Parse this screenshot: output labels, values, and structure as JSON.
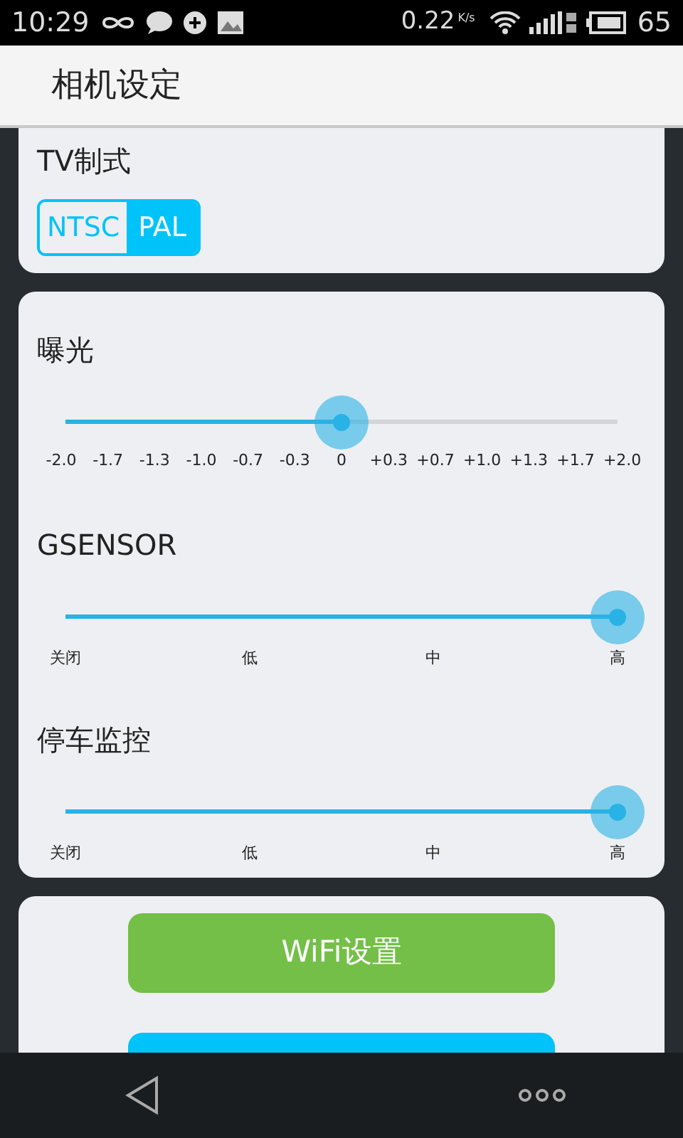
{
  "status_bar": {
    "time": "10:29",
    "speed": "0.22",
    "speed_unit": "K/s",
    "battery": "65"
  },
  "app_bar": {
    "title": "相机设定"
  },
  "tv_system": {
    "title": "TV制式",
    "options": [
      {
        "label": "NTSC",
        "selected": false
      },
      {
        "label": "PAL",
        "selected": true
      }
    ]
  },
  "sliders": [
    {
      "title": "曝光",
      "level": 0.5,
      "labels": [
        "-2.0",
        "-1.7",
        "-1.3",
        "-1.0",
        "-0.7",
        "-0.3",
        "0",
        "+0.3",
        "+0.7",
        "+1.0",
        "+1.3",
        "+1.7",
        "+2.0"
      ]
    },
    {
      "title": "GSENSOR",
      "level": 1,
      "labels": [
        "关闭",
        "低",
        "中",
        "高"
      ]
    },
    {
      "title": "停车监控",
      "level": 1,
      "labels": [
        "关闭",
        "低",
        "中",
        "高"
      ]
    }
  ],
  "buttons": [
    {
      "kind": "green",
      "label": "WiFi设置"
    },
    {
      "kind": "blue"
    }
  ]
}
